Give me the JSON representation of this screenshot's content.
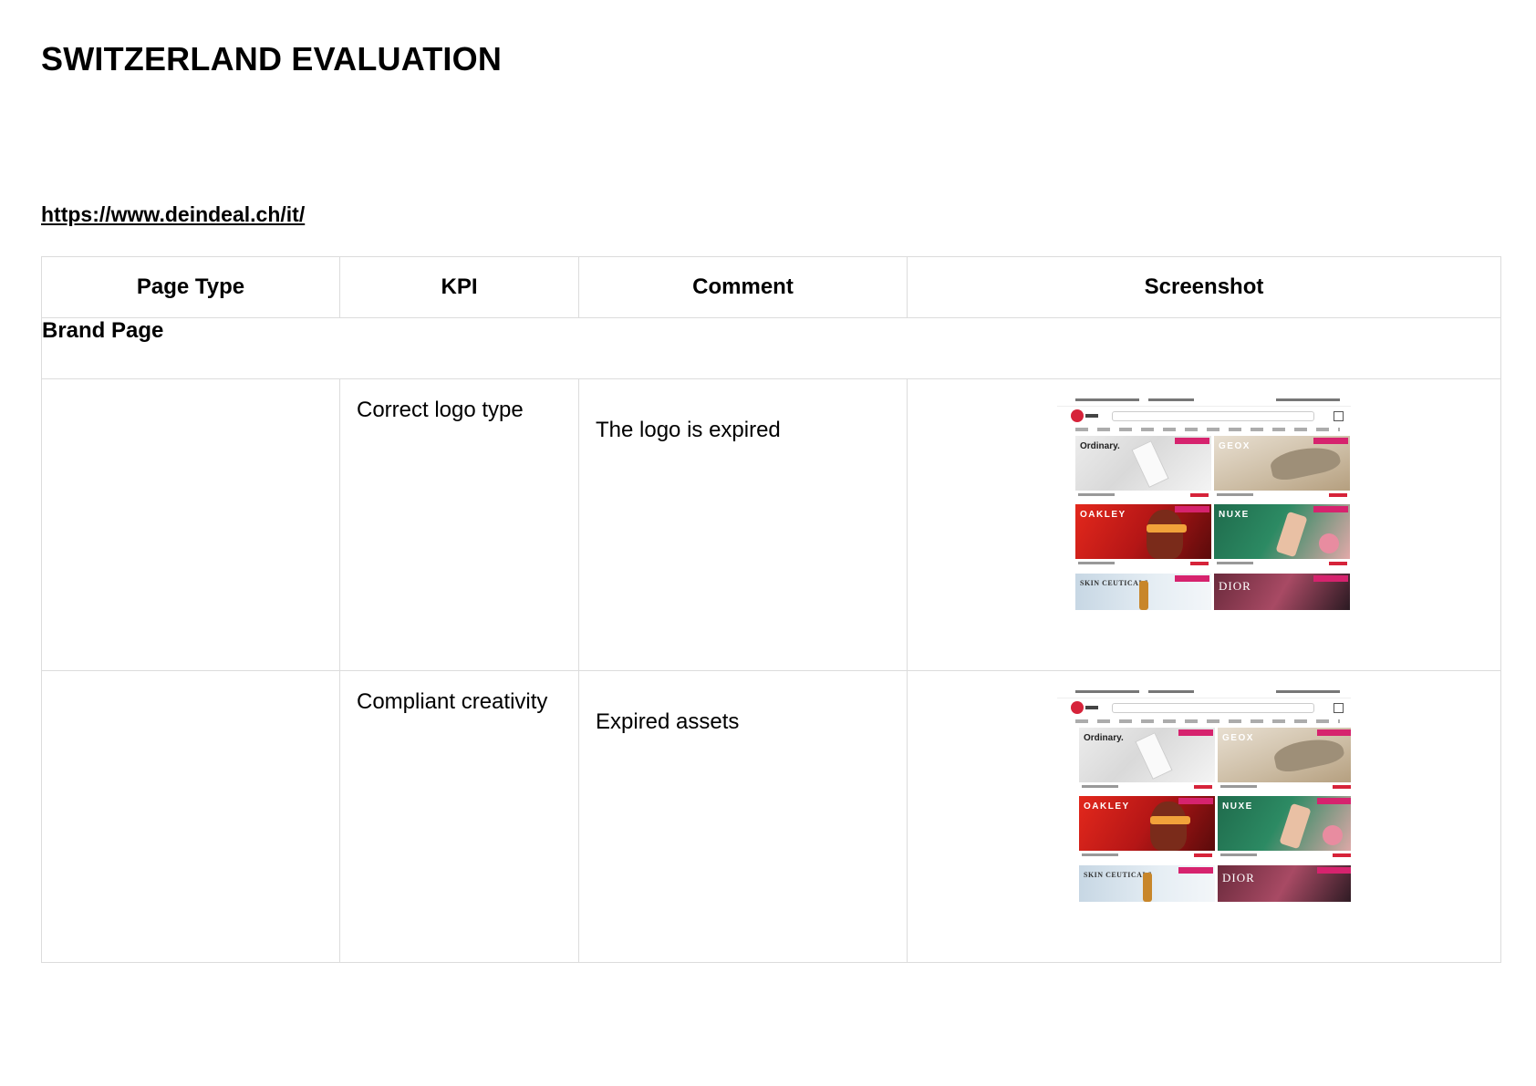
{
  "document": {
    "title": "SWITZERLAND EVALUATION",
    "url": "https://www.deindeal.ch/it/"
  },
  "table": {
    "headers": {
      "page_type": "Page Type",
      "kpi": "KPI",
      "comment": "Comment",
      "screenshot": "Screenshot"
    },
    "section": "Brand Page",
    "rows": [
      {
        "page_type": "",
        "kpi": "Correct logo type",
        "comment": "The logo is expired"
      },
      {
        "page_type": "",
        "kpi": "Compliant creativity",
        "comment": "Expired assets"
      }
    ]
  },
  "screenshot_thumbnail": {
    "tiles": [
      "Ordinary.",
      "GEOX",
      "OAKLEY",
      "NUXE",
      "SKIN CEUTICALS",
      "DIOR"
    ]
  },
  "colors": {
    "border": "#dcdcdc",
    "brand_red": "#d6233a",
    "price_drop_tag": "#d6236e"
  }
}
